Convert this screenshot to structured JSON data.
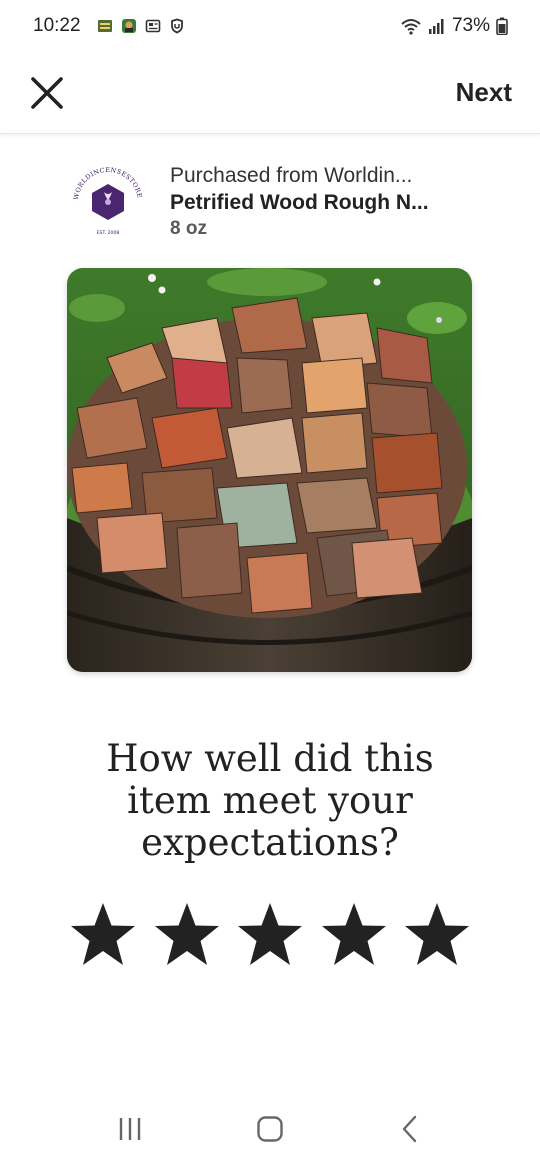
{
  "status_bar": {
    "time": "10:22",
    "battery": "73%"
  },
  "top_bar": {
    "close_icon": "close-icon",
    "next_label": "Next"
  },
  "purchase": {
    "from_text": "Purchased from Worldin...",
    "item_title": "Petrified Wood Rough N...",
    "variant": "8 oz",
    "logo_text": "WORLDINCENSESTORE",
    "logo_est": "EST. 2008"
  },
  "question": "How well did this item meet your expectations?",
  "rating": {
    "max": 5,
    "star_icon": "star-icon",
    "star_color": "#222222"
  },
  "nav_bar": {
    "recents_icon": "recents-icon",
    "home_icon": "home-icon",
    "back_icon": "back-icon"
  }
}
